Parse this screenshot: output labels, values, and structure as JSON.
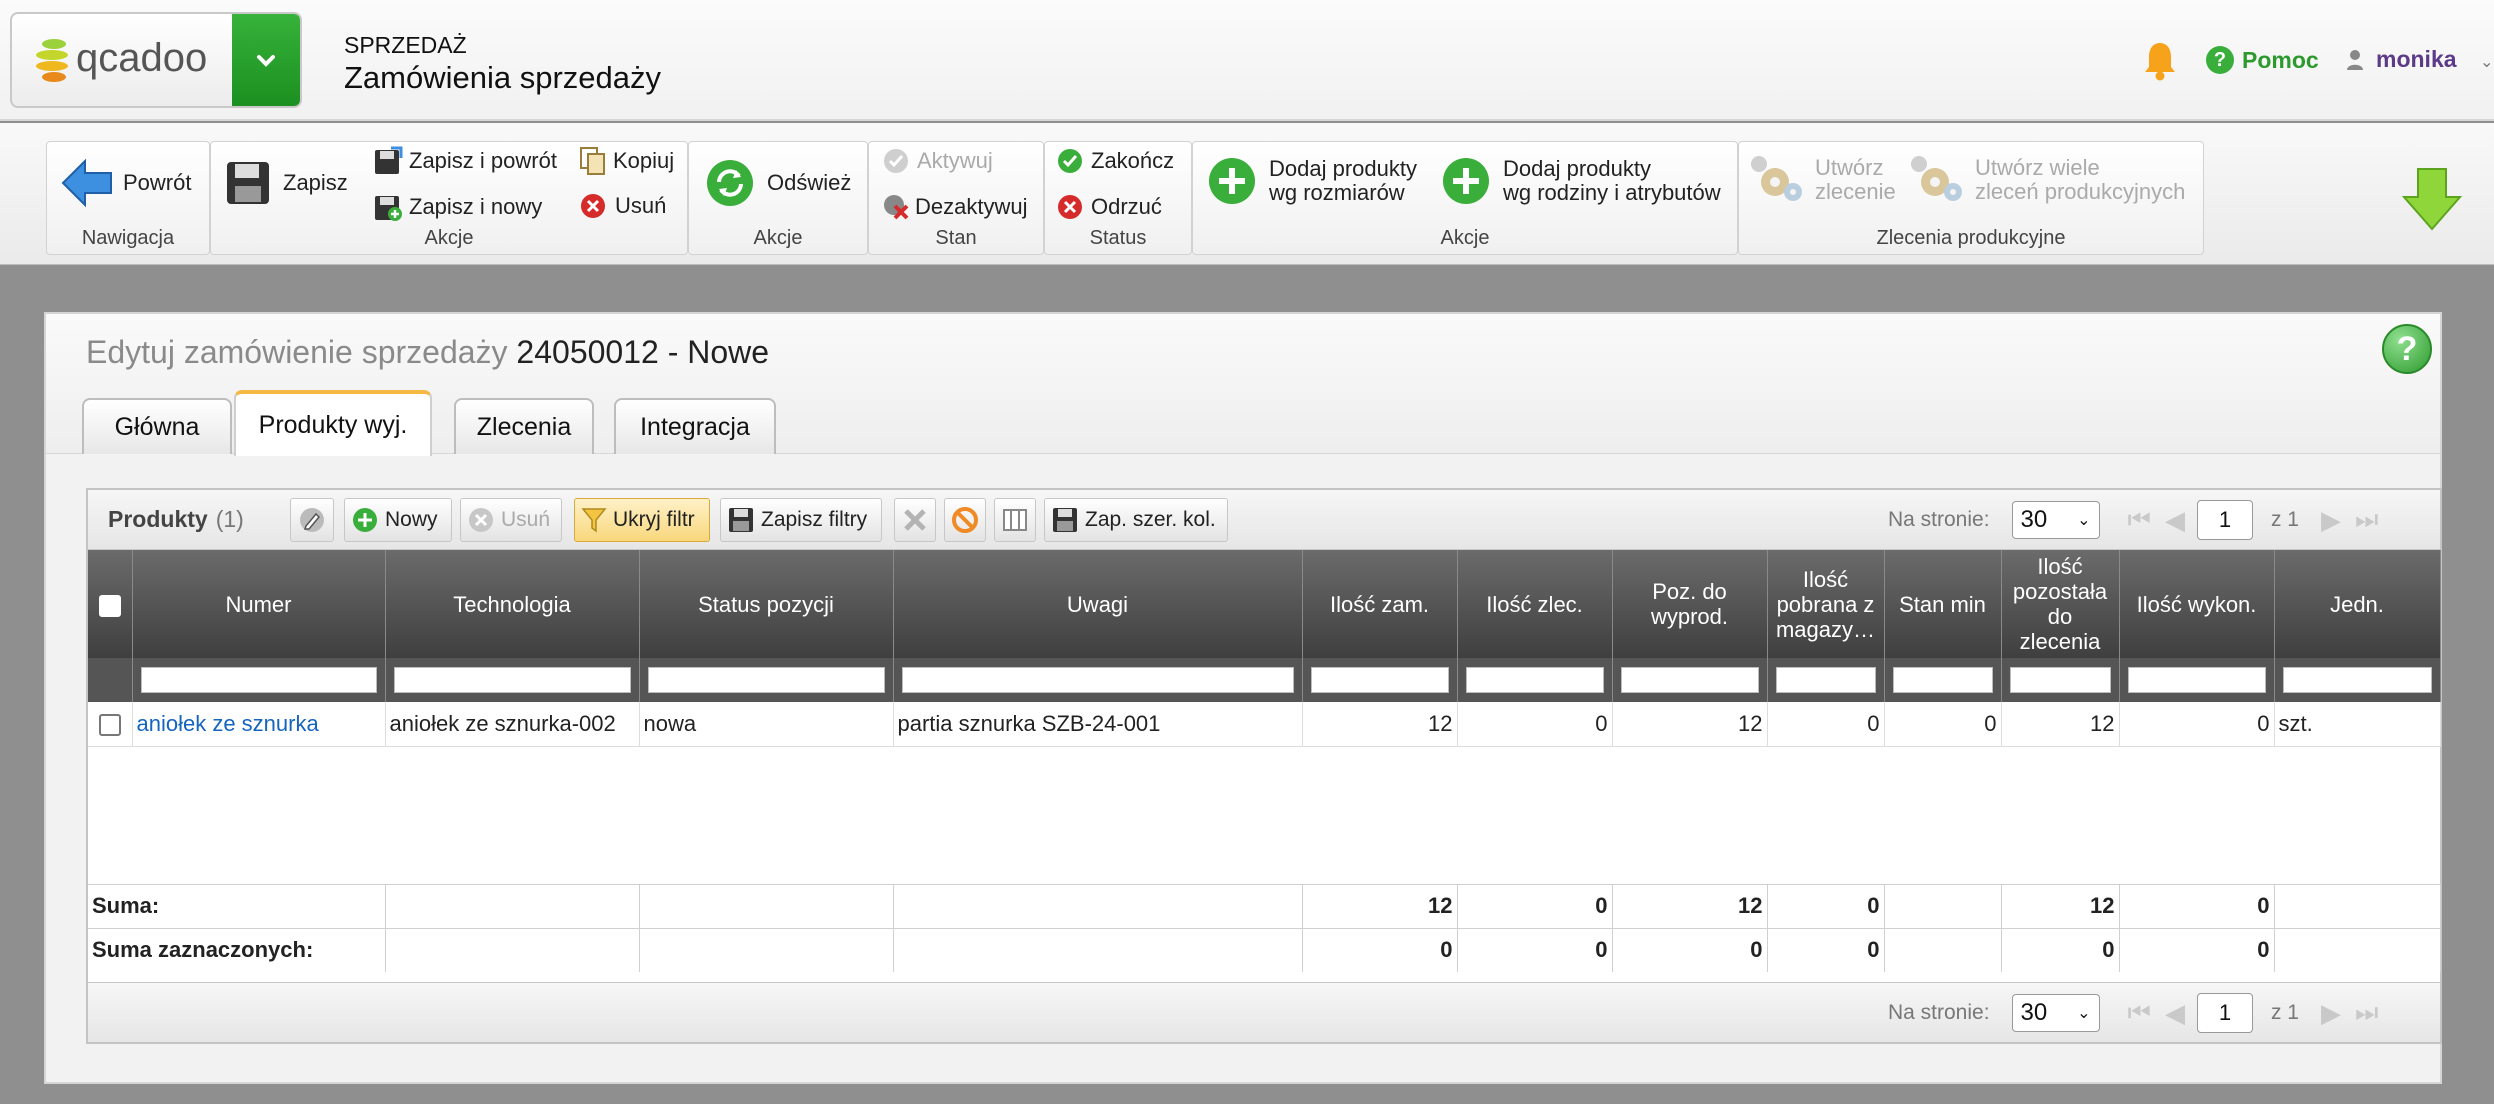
{
  "header": {
    "logo_text": "qcadoo",
    "module": "SPRZEDAŻ",
    "page": "Zamówienia sprzedaży",
    "help": "Pomoc",
    "user": "monika"
  },
  "ribbon": {
    "groups": {
      "nawigacja": "Nawigacja",
      "akcje1": "Akcje",
      "akcje2": "Akcje",
      "stan": "Stan",
      "status": "Status",
      "akcje3": "Akcje",
      "zlecenia": "Zlecenia produkcyjne"
    },
    "buttons": {
      "back": "Powrót",
      "save": "Zapisz",
      "save_back": "Zapisz i powrót",
      "save_new": "Zapisz i nowy",
      "copy": "Kopiuj",
      "delete": "Usuń",
      "refresh": "Odśwież",
      "activate": "Aktywuj",
      "deactivate": "Dezaktywuj",
      "finish": "Zakończ",
      "reject": "Odrzuć",
      "add_by_size_1": "Dodaj produkty",
      "add_by_size_2": "wg rozmiarów",
      "add_by_family_1": "Dodaj produkty",
      "add_by_family_2": "wg rodziny i atrybutów",
      "create_order_1": "Utwórz",
      "create_order_2": "zlecenie",
      "create_many_1": "Utwórz wiele",
      "create_many_2": "zleceń produkcyjnych"
    }
  },
  "panel": {
    "title_prefix": "Edytuj zamówienie sprzedaży",
    "title_value": "24050012 - Nowe",
    "tabs": [
      "Główna",
      "Produkty wyj.",
      "Zlecenia",
      "Integracja"
    ]
  },
  "grid": {
    "title": "Produkty",
    "count": "(1)",
    "toolbar": {
      "new": "Nowy",
      "delete": "Usuń",
      "hide_filter": "Ukryj filtr",
      "save_filters": "Zapisz filtry",
      "save_col_width": "Zap. szer. kol."
    },
    "pager": {
      "per_page_label": "Na stronie:",
      "per_page": "30",
      "page": "1",
      "of": "z 1"
    },
    "columns": [
      "Numer",
      "Technologia",
      "Status pozycji",
      "Uwagi",
      "Ilość zam.",
      "Ilość zlec.",
      "Poz. do wyprod.",
      "Ilość pobrana z magazy…",
      "Stan min",
      "Ilość pozostała do zlecenia",
      "Ilość wykon.",
      "Jedn."
    ],
    "rows": [
      {
        "numer": "aniołek ze sznurka",
        "technologia": "aniołek ze sznurka-002",
        "status": "nowa",
        "uwagi": "partia sznurka SZB-24-001",
        "ilosc_zam": "12",
        "ilosc_zlec": "0",
        "poz_do_wyprod": "12",
        "ilosc_pobrana": "0",
        "stan_min": "0",
        "ilosc_pozostala": "12",
        "ilosc_wykon": "0",
        "jedn": "szt."
      }
    ],
    "sum": {
      "label": "Suma:",
      "ilosc_zam": "12",
      "ilosc_zlec": "0",
      "poz_do_wyprod": "12",
      "ilosc_pobrana": "0",
      "ilosc_pozostala": "12",
      "ilosc_wykon": "0"
    },
    "sum_selected": {
      "label": "Suma zaznaczonych:",
      "ilosc_zam": "0",
      "ilosc_zlec": "0",
      "poz_do_wyprod": "0",
      "ilosc_pobrana": "0",
      "ilosc_pozostala": "0",
      "ilosc_wykon": "0"
    }
  },
  "colors": {
    "brand_green": "#1b8f20",
    "accent_tab": "#f4b942",
    "link": "#1565c0",
    "user": "#5b3a87"
  }
}
